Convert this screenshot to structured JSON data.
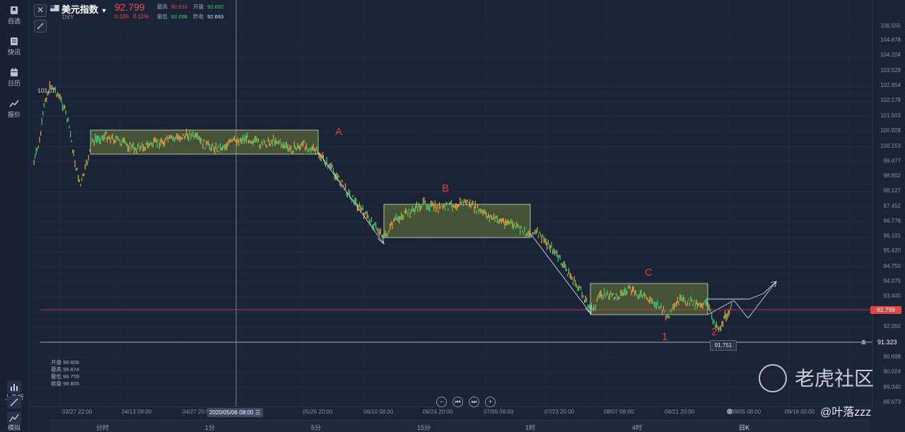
{
  "sidebar": {
    "items": [
      {
        "label": "自选",
        "icon": "bookmark-icon"
      },
      {
        "label": "快讯",
        "icon": "news-icon"
      },
      {
        "label": "日历",
        "icon": "calendar-icon"
      },
      {
        "label": "报价",
        "icon": "quote-chart-icon"
      }
    ],
    "bottom_items": [
      {
        "label": "上交所",
        "icon": "exchange-icon"
      },
      {
        "label": "模拟",
        "icon": "simulate-icon"
      }
    ]
  },
  "header": {
    "title": "美元指数",
    "subtitle": "DXY",
    "price": "92.799",
    "change": "0.106",
    "change_pct": "0.11%",
    "high_label": "最高",
    "high": "92.833",
    "open_label": "开盘",
    "open": "92.692",
    "low_label": "最低",
    "low": "92.688",
    "prev_close_label": "昨收",
    "prev_close": "92.693"
  },
  "chart": {
    "price_tag": "92.799",
    "hline_value": "91.323",
    "low_tag": "91.751",
    "high_tag": "103.01",
    "wave_labels": [
      "A",
      "B",
      "C",
      "1",
      "2"
    ],
    "crosshair_date": "2020/05/06 08:00 三",
    "y_ticks": [
      "106.555",
      "104.878",
      "104.204",
      "103.528",
      "102.854",
      "102.178",
      "101.503",
      "100.828",
      "100.153",
      "99.477",
      "98.802",
      "98.127",
      "97.452",
      "96.778",
      "96.101",
      "95.420",
      "94.750",
      "94.075",
      "93.400",
      "92.050",
      "90.698",
      "90.024",
      "89.340",
      "88.673"
    ],
    "x_ticks": [
      "03/27 22:00",
      "04/13 08:00",
      "04/27 20:00",
      "05/26 20:00",
      "06/10 08:00",
      "06/24 20:00",
      "07/09 08:00",
      "07/23 20:00",
      "08/07 08:00",
      "08/21 20:00",
      "09/05 08:00",
      "09/16 00:00"
    ],
    "legend": {
      "open_label": "开盘",
      "open": "99.806",
      "high_label": "最高",
      "high": "99.874",
      "low_label": "最低",
      "low": "99.759",
      "close_label": "收盘",
      "close": "99.805"
    },
    "colors": {
      "up": "#3fcf6a",
      "down": "#f0a040",
      "box": "#7d8c3a",
      "price_line": "#e04444"
    }
  },
  "periods": [
    "分时",
    "1分",
    "5分",
    "15分",
    "1时",
    "4时",
    "日K"
  ],
  "watermark": "老虎社区",
  "credit": "@叶落zzz"
}
